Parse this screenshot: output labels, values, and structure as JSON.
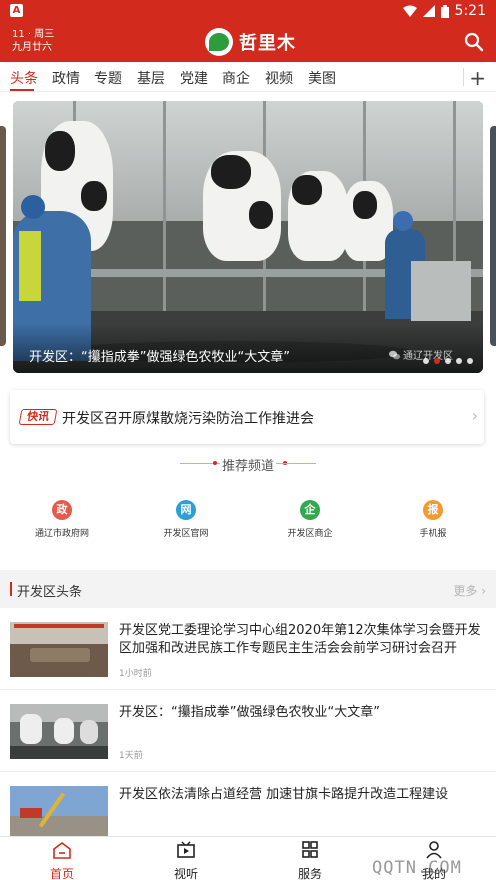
{
  "status_bar": {
    "notification_icon": "A",
    "time": "5:21"
  },
  "header": {
    "date_line1": "11 · 周三",
    "date_line2": "九月廿六",
    "logo_text": "哲里木",
    "search_icon": "search-icon"
  },
  "tabs": [
    "头条",
    "政情",
    "专题",
    "基层",
    "党建",
    "商企",
    "视频",
    "美图"
  ],
  "tabs_active_index": 0,
  "banner": {
    "caption": "开发区：“攥指成拳”做强绿色农牧业“大文章”",
    "source": "通辽开发区",
    "dot_count": 5,
    "active_dot": 1
  },
  "flash": {
    "badge": "快讯",
    "text": "开发区召开原煤散烧污染防治工作推进会"
  },
  "recommended": {
    "title": "推荐频道",
    "channels": [
      {
        "label": "通辽市政府网",
        "color": "#e55a4e",
        "glyph": "政"
      },
      {
        "label": "开发区官网",
        "color": "#2d9ed6",
        "glyph": "网"
      },
      {
        "label": "开发区商企",
        "color": "#32a84f",
        "glyph": "企"
      },
      {
        "label": "手机报",
        "color": "#f29a2e",
        "glyph": "报"
      }
    ]
  },
  "section": {
    "title": "开发区头条",
    "more": "更多 ›"
  },
  "news": [
    {
      "headline": "开发区党工委理论学习中心组2020年第12次集体学习会暨开发区加强和改进民族工作专题民主生活会会前学习研讨会召开",
      "time": "1小时前"
    },
    {
      "headline": "开发区：“攥指成拳”做强绿色农牧业“大文章”",
      "time": "1天前"
    },
    {
      "headline": "开发区依法清除占道经营  加速甘旗卡路提升改造工程建设",
      "time": ""
    }
  ],
  "bottom_nav": [
    {
      "label": "首页",
      "active": true
    },
    {
      "label": "视听",
      "active": false
    },
    {
      "label": "服务",
      "active": false
    },
    {
      "label": "我的",
      "active": false
    }
  ],
  "watermark": "QQTN.COM",
  "colors": {
    "brand_red": "#d22b1e"
  }
}
